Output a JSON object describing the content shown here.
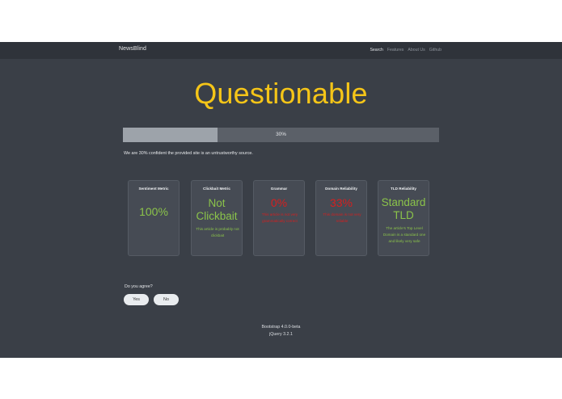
{
  "navbar": {
    "brand": "NewsBlind",
    "links": [
      {
        "label": "Search",
        "active": true
      },
      {
        "label": "Features",
        "active": false
      },
      {
        "label": "About Us",
        "active": false
      },
      {
        "label": "Github",
        "active": false
      }
    ]
  },
  "result": {
    "verdict": "Questionable",
    "verdict_color": "#f5c518",
    "confidence_percent": 30,
    "progress_label": "30%",
    "confidence_text": "We are 30% confident the provided site is an untrustworthy source."
  },
  "metrics": [
    {
      "title": "Sentiment Metric",
      "value": "100%",
      "description": "",
      "status": "green"
    },
    {
      "title": "Clickbait Metric",
      "value": "Not Clickbait",
      "description": "This article is probably not clickbait",
      "status": "green"
    },
    {
      "title": "Grammar",
      "value": "0%",
      "description": "This article is not very grammatically correct",
      "status": "red"
    },
    {
      "title": "Domain Reliability",
      "value": "33%",
      "description": "This domain is not very reliable",
      "status": "red"
    },
    {
      "title": "TLD Reliability",
      "value": "Standard TLD",
      "description": "The article's Top Level Domain is a standard one and likely very safe",
      "status": "green"
    }
  ],
  "feedback": {
    "question": "Do you agree?",
    "yes_label": "Yes",
    "no_label": "No"
  },
  "footer": {
    "line1": "Bootstrap 4.0.0-beta",
    "line2": "jQuery 3.2.1"
  },
  "colors": {
    "background": "#3a3f47",
    "navbar": "#2f333a",
    "good": "#8bc34a",
    "bad": "#d61f1f"
  }
}
